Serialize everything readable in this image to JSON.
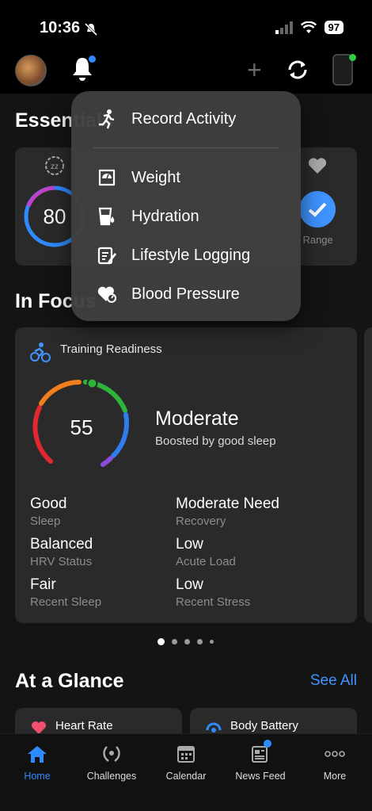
{
  "status": {
    "time": "10:36",
    "battery": "97"
  },
  "essentials": {
    "title": "Essentials",
    "sleep_score": "80",
    "range_label": "In Range"
  },
  "menu": {
    "items": [
      {
        "label": "Record Activity",
        "icon": "running-icon"
      },
      {
        "label": "Weight",
        "icon": "scale-icon"
      },
      {
        "label": "Hydration",
        "icon": "hydration-icon"
      },
      {
        "label": "Lifestyle Logging",
        "icon": "lifestyle-icon"
      },
      {
        "label": "Blood Pressure",
        "icon": "blood-pressure-icon"
      }
    ]
  },
  "focus": {
    "title": "In Focus",
    "card_title": "Training Readiness",
    "score": "55",
    "score_value": 55,
    "level": "Moderate",
    "level_note": "Boosted by good sleep",
    "metrics": [
      {
        "value": "Good",
        "label": "Sleep"
      },
      {
        "value": "Moderate Need",
        "label": "Recovery"
      },
      {
        "value": "Balanced",
        "label": "HRV Status"
      },
      {
        "value": "Low",
        "label": "Acute Load"
      },
      {
        "value": "Fair",
        "label": "Recent Sleep"
      },
      {
        "value": "Low",
        "label": "Recent Stress"
      }
    ]
  },
  "glance": {
    "title": "At a Glance",
    "see_all": "See All",
    "cards": [
      {
        "label": "Heart Rate"
      },
      {
        "label": "Body Battery"
      }
    ]
  },
  "tabs": [
    {
      "label": "Home",
      "active": true
    },
    {
      "label": "Challenges"
    },
    {
      "label": "Calendar"
    },
    {
      "label": "News Feed"
    },
    {
      "label": "More"
    }
  ],
  "colors": {
    "accent": "#3f94ff",
    "active_tab": "#2e8bff",
    "card": "#2a2a2a"
  }
}
